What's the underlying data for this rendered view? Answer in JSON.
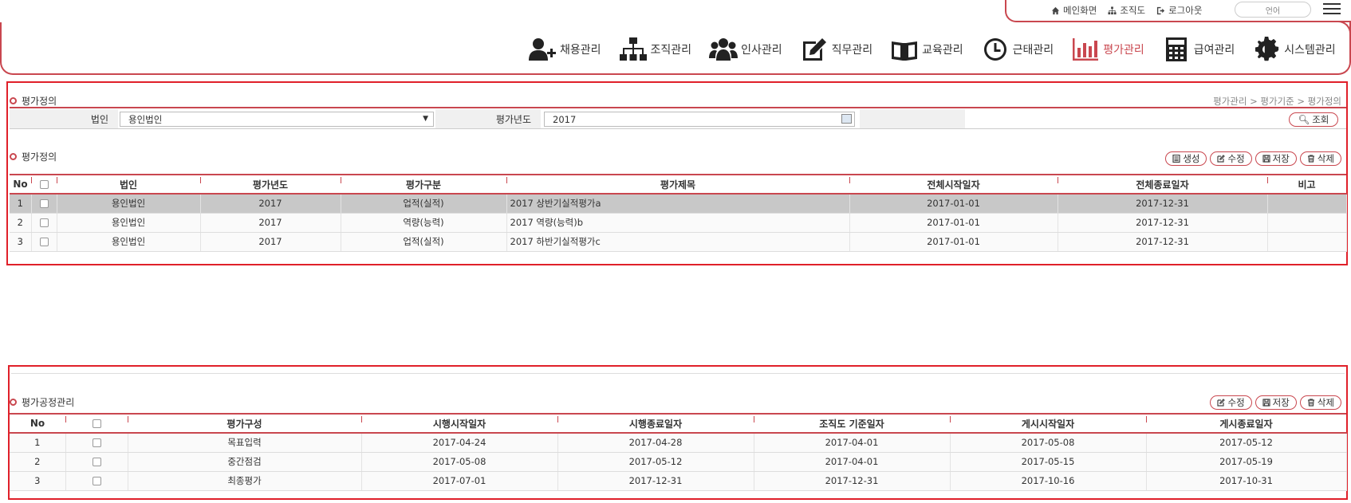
{
  "top_util": {
    "home": "메인화면",
    "org": "조직도",
    "logout": "로그아웃",
    "language": "언어"
  },
  "nav": [
    {
      "label": "채용관리",
      "icon": "add-user-icon"
    },
    {
      "label": "조직관리",
      "icon": "org-chart-icon"
    },
    {
      "label": "인사관리",
      "icon": "people-icon"
    },
    {
      "label": "직무관리",
      "icon": "edit-icon"
    },
    {
      "label": "교육관리",
      "icon": "book-icon"
    },
    {
      "label": "근태관리",
      "icon": "clock-icon"
    },
    {
      "label": "평가관리",
      "icon": "bar-chart-icon",
      "active": true
    },
    {
      "label": "급여관리",
      "icon": "calculator-icon"
    },
    {
      "label": "시스템관리",
      "icon": "gear-icon"
    }
  ],
  "section1": {
    "title": "평가정의",
    "breadcrumb": "평가관리 > 평가기준 > 평가정의",
    "search": {
      "corp_label": "법인",
      "corp_value": "용인법인",
      "year_label": "평가년도",
      "year_value": "2017",
      "search_button": "조회"
    }
  },
  "grid1": {
    "title": "평가정의",
    "buttons": {
      "create": "생성",
      "edit": "수정",
      "save": "저장",
      "delete": "삭제"
    },
    "columns": [
      "No",
      "",
      "법인",
      "평가년도",
      "평가구분",
      "평가제목",
      "전체시작일자",
      "전체종료일자",
      "비고"
    ],
    "rows": [
      {
        "no": "1",
        "corp": "용인법인",
        "year": "2017",
        "type": "업적(실적)",
        "title": "2017 상반기실적평가a",
        "start": "2017-01-01",
        "end": "2017-12-31",
        "note": ""
      },
      {
        "no": "2",
        "corp": "용인법인",
        "year": "2017",
        "type": "역량(능력)",
        "title": "2017 역량(능력)b",
        "start": "2017-01-01",
        "end": "2017-12-31",
        "note": ""
      },
      {
        "no": "3",
        "corp": "용인법인",
        "year": "2017",
        "type": "업적(실적)",
        "title": "2017 하반기실적평가c",
        "start": "2017-01-01",
        "end": "2017-12-31",
        "note": ""
      }
    ]
  },
  "grid2": {
    "title": "평가공정관리",
    "buttons": {
      "edit": "수정",
      "save": "저장",
      "delete": "삭제"
    },
    "columns": [
      "No",
      "",
      "평가구성",
      "시행시작일자",
      "시행종료일자",
      "조직도 기준일자",
      "게시시작일자",
      "게시종료일자"
    ],
    "rows": [
      {
        "no": "1",
        "comp": "목표입력",
        "start": "2017-04-24",
        "end": "2017-04-28",
        "org_date": "2017-04-01",
        "post_start": "2017-05-08",
        "post_end": "2017-05-12"
      },
      {
        "no": "2",
        "comp": "중간점검",
        "start": "2017-05-08",
        "end": "2017-05-12",
        "org_date": "2017-04-01",
        "post_start": "2017-05-15",
        "post_end": "2017-05-19"
      },
      {
        "no": "3",
        "comp": "최종평가",
        "start": "2017-07-01",
        "end": "2017-12-31",
        "org_date": "2017-12-31",
        "post_start": "2017-10-16",
        "post_end": "2017-10-31"
      }
    ]
  }
}
